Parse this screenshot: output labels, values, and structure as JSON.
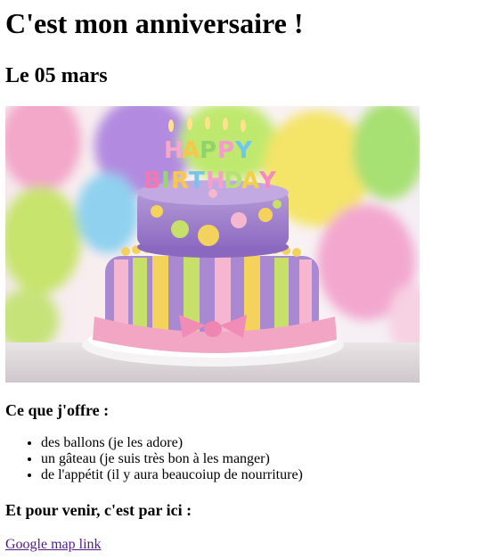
{
  "page": {
    "title": "C'est mon anniversaire !",
    "date": "Le 05 mars",
    "image": {
      "candles_text": "HAPPY BIRTHDAY",
      "colors": {
        "candle_letters": [
          "#f7a8c8",
          "#f5c84a",
          "#8fd36b",
          "#f59bd0",
          "#6fc7f0",
          "#f3d04a",
          "#f07ab0",
          "#9ad76a",
          "#f6c94c",
          "#79c2ee",
          "#f59fcf",
          "#b8e07a",
          "#f48cbf"
        ]
      }
    },
    "offer_heading": "Ce que j'offre :",
    "offer_items": [
      "des ballons (je les adore)",
      "un gâteau (je suis très bon à les manger)",
      "de l'appétit (il y aura beaucoiup de nourriture)"
    ],
    "directions_heading": "Et pour venir, c'est par ici :",
    "map_link_label": "Google map link"
  }
}
